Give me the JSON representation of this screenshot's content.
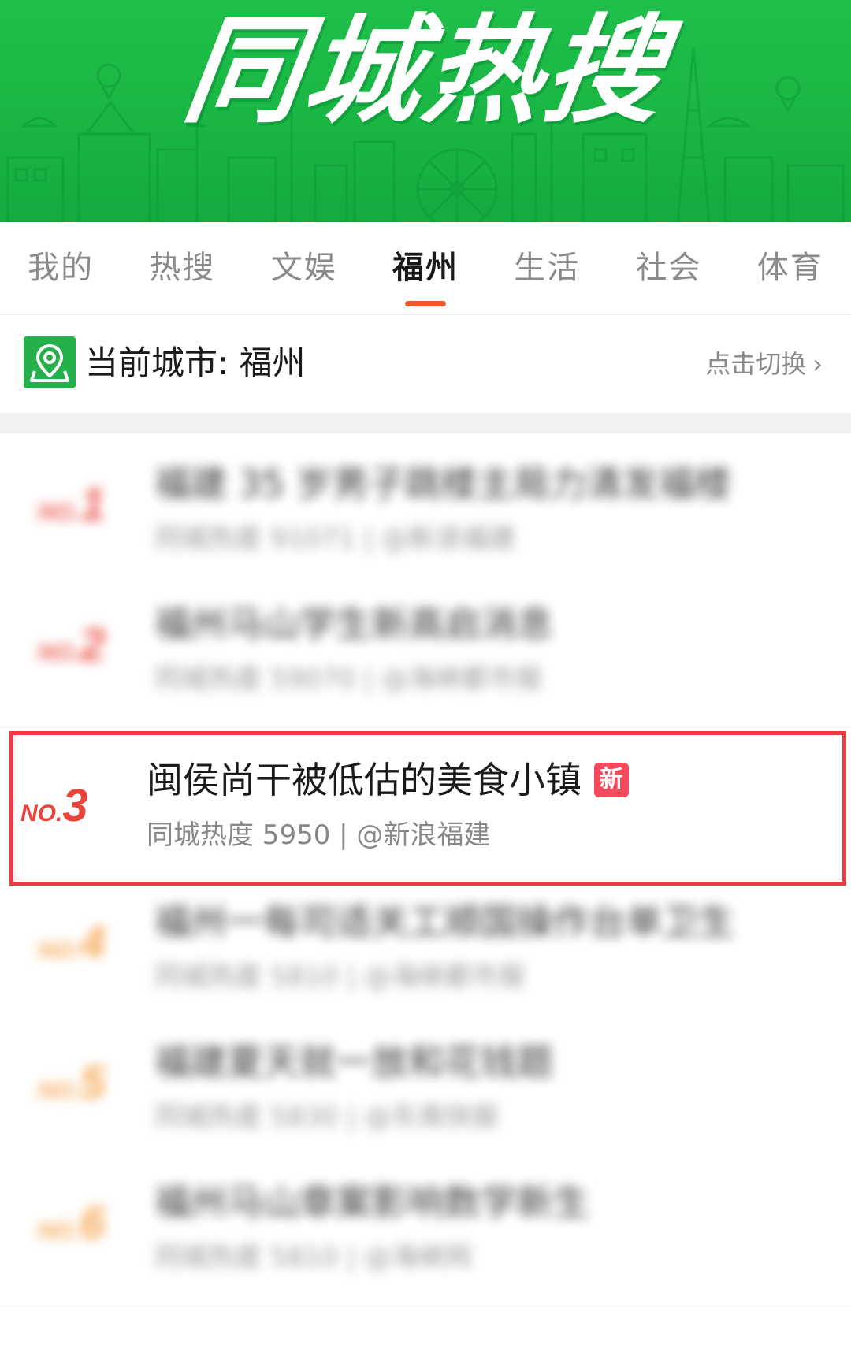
{
  "banner": {
    "title": "同城热搜",
    "background_color": "#1fbf4a"
  },
  "tabs": [
    {
      "label": "我的",
      "active": false
    },
    {
      "label": "热搜",
      "active": false
    },
    {
      "label": "文娱",
      "active": false
    },
    {
      "label": "福州",
      "active": true
    },
    {
      "label": "生活",
      "active": false
    },
    {
      "label": "社会",
      "active": false
    },
    {
      "label": "体育",
      "active": false
    }
  ],
  "city": {
    "label": "当前城市: 福州",
    "switch_label": "点击切换",
    "icon": "location-pin-icon"
  },
  "list": {
    "highlight_color": "#ee3b43",
    "items": [
      {
        "rank_prefix": "NO.",
        "rank_number": "1",
        "rank_color": "#e8443a",
        "title": "福建 35 岁男子跳楼主局力清发福楼",
        "meta": "同城热度 91071 | @新浪福建",
        "blurred": true
      },
      {
        "rank_prefix": "NO.",
        "rank_number": "2",
        "rank_color": "#e8443a",
        "title": "福州马山学生新高启消息",
        "meta": "同城热度 59070 | @海峡都市报",
        "blurred": true
      },
      {
        "rank_prefix": "NO.",
        "rank_number": "3",
        "rank_color": "#e8443a",
        "title": "闽侯尚干被低估的美食小镇",
        "meta": "同城热度 5950 | @新浪福建",
        "badge": "新",
        "blurred": false
      },
      {
        "rank_prefix": "NO.",
        "rank_number": "4",
        "rank_color": "#f39a3a",
        "title": "福州一每司适关工顺国操作台单卫生",
        "meta": "同城热度 5810 | @海峡都市报",
        "blurred": true
      },
      {
        "rank_prefix": "NO.",
        "rank_number": "5",
        "rank_color": "#f39a3a",
        "title": "福建夏天就一放和花钱题",
        "meta": "同城热度 5830 | @东南快报",
        "blurred": true
      },
      {
        "rank_prefix": "NO.",
        "rank_number": "6",
        "rank_color": "#f39a3a",
        "title": "福州马山章案影响数学新生",
        "meta": "同城热度 5810 | @海峡网",
        "blurred": true
      }
    ]
  }
}
